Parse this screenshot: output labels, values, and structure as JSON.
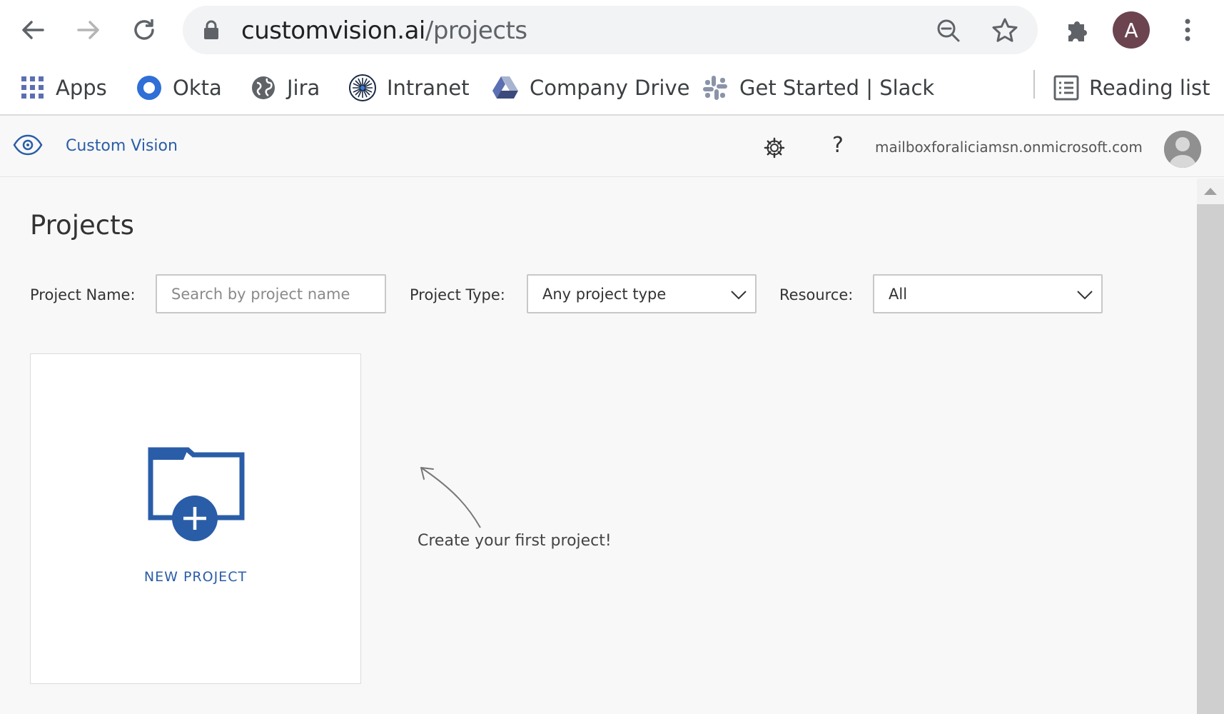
{
  "browser": {
    "url_domain": "customvision.ai",
    "url_path": "/projects",
    "profile_initial": "A",
    "icons": [
      "back-arrow-icon",
      "forward-arrow-icon",
      "reload-icon",
      "lock-icon",
      "zoom-out-icon",
      "star-icon",
      "extensions-icon",
      "more-vert-icon"
    ]
  },
  "bookmarks": [
    {
      "label": "Apps",
      "icon": "apps-grid-icon"
    },
    {
      "label": "Okta",
      "icon": "okta-icon"
    },
    {
      "label": "Jira",
      "icon": "globe-icon"
    },
    {
      "label": "Intranet",
      "icon": "intranet-icon"
    },
    {
      "label": "Company Drive",
      "icon": "drive-icon"
    },
    {
      "label": "Get Started | Slack",
      "icon": "slack-icon"
    }
  ],
  "reading_list": {
    "label": "Reading list",
    "icon": "reading-list-icon"
  },
  "app_header": {
    "brand": "Custom Vision",
    "help": "?",
    "user_email": "mailboxforaliciamsn.onmicrosoft.com"
  },
  "main": {
    "title": "Projects",
    "filters": {
      "project_name_label": "Project Name:",
      "project_name_placeholder": "Search by project name",
      "project_type_label": "Project Type:",
      "project_type_value": "Any project type",
      "resource_label": "Resource:",
      "resource_value": "All"
    },
    "new_project_label": "NEW PROJECT",
    "hint": "Create your first project!"
  },
  "colors": {
    "brand_blue": "#2a5da8",
    "profile_bg": "#6b4450"
  }
}
